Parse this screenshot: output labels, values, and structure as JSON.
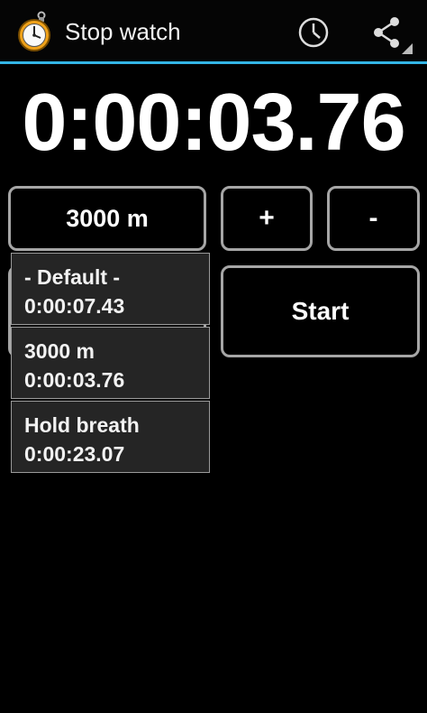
{
  "app": {
    "title": "Stop watch"
  },
  "colors": {
    "accent": "#33b5e5",
    "background": "#000000",
    "button_border": "#a6a6a6"
  },
  "actions": {
    "history_icon": "clock-icon",
    "share_icon": "share-icon"
  },
  "timer": {
    "display": "0:00:03.76"
  },
  "controls": {
    "distance_label": "3000 m",
    "plus_label": "+",
    "minus_label": "-",
    "start_label": "Start"
  },
  "dropdown": {
    "items": [
      {
        "name": "- Default -",
        "time": "0:00:07.43"
      },
      {
        "name": "3000 m",
        "time": "0:00:03.76"
      },
      {
        "name": "Hold breath",
        "time": "0:00:23.07"
      }
    ]
  }
}
